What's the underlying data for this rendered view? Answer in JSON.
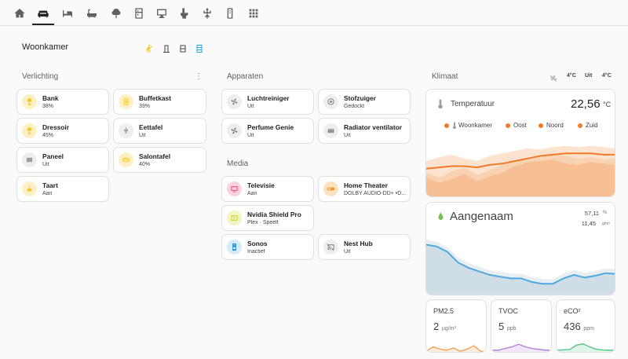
{
  "nav": {
    "tabs": [
      {
        "icon": "home-icon"
      },
      {
        "icon": "sofa-icon",
        "active": true
      },
      {
        "icon": "bed-icon"
      },
      {
        "icon": "bathtub-icon"
      },
      {
        "icon": "tree-icon"
      },
      {
        "icon": "fridge-icon"
      },
      {
        "icon": "desktop-icon"
      },
      {
        "icon": "toilet-icon"
      },
      {
        "icon": "antenna-icon"
      },
      {
        "icon": "remote-icon"
      },
      {
        "icon": "grid-icon"
      }
    ]
  },
  "room": {
    "title": "Woonkamer",
    "header_icons": [
      "motion-icon",
      "door-icon",
      "window-icon",
      "cabinet-icon"
    ]
  },
  "lighting": {
    "title": "Verlichting",
    "menu": "⋮",
    "tiles": [
      {
        "name": "Bank",
        "state": "38%",
        "icon": "lamp-icon",
        "on": true
      },
      {
        "name": "Buffetkast",
        "state": "39%",
        "icon": "lamp-icon",
        "on": true
      },
      {
        "name": "Dressoir",
        "state": "45%",
        "icon": "lamp-icon",
        "on": true
      },
      {
        "name": "Eettafel",
        "state": "Uit",
        "icon": "chandelier-icon",
        "on": false
      },
      {
        "name": "Paneel",
        "state": "Uit",
        "icon": "panel-icon",
        "on": false
      },
      {
        "name": "Salontafel",
        "state": "40%",
        "icon": "ceiling-light-icon",
        "on": true
      },
      {
        "name": "Taart",
        "state": "Aan",
        "icon": "cake-icon",
        "on": true
      }
    ]
  },
  "devices": {
    "title": "Apparaten",
    "tiles": [
      {
        "name": "Luchtreiniger",
        "state": "Uit",
        "icon": "fan-icon"
      },
      {
        "name": "Stofzuiger",
        "state": "Gedockt",
        "icon": "robot-vacuum-icon"
      },
      {
        "name": "Perfume Genie",
        "state": "Uit",
        "icon": "fan-icon"
      },
      {
        "name": "Radiator ventilator",
        "state": "Uit",
        "icon": "radiator-icon"
      }
    ]
  },
  "media": {
    "title": "Media",
    "tiles": [
      {
        "name": "Televisie",
        "state": "Aan",
        "icon": "tv-icon"
      },
      {
        "name": "Home Theater",
        "state": "DOLBY AUDIO-DD+ •D...",
        "icon": "receiver-icon"
      },
      {
        "name": "Nvidia Shield Pro",
        "state": "Plex · Speelt",
        "icon": "play-icon"
      },
      {
        "name": "Sonos",
        "state": "Inactief",
        "icon": "speaker-icon"
      },
      {
        "name": "Nest Hub",
        "state": "Uit",
        "icon": "cast-off-icon"
      }
    ]
  },
  "climate": {
    "title": "Klimaat",
    "top": [
      {
        "icon": "no-wind-icon"
      },
      {
        "label": "4°C"
      },
      {
        "label": "Uit"
      },
      {
        "label": "4°C"
      }
    ],
    "temperature": {
      "label": "Temperatuur",
      "value": "22,56",
      "unit": "°C",
      "legend": [
        "Woonkamer",
        "Oost",
        "Noord",
        "Zuid"
      ],
      "colors": {
        "main": "#f07b26",
        "fill": "#f7c9a3"
      }
    },
    "air": {
      "label": "Aangenaam",
      "humidity": "57,11",
      "humidity_unit": "%",
      "abs": "11,45",
      "abs_unit": "g/m³",
      "colors": {
        "line": "#4fa8e0",
        "fill": "#cfdde6"
      }
    },
    "sensors": [
      {
        "label": "PM2.5",
        "value": "2",
        "unit": "µg/m³",
        "color": "#f39c4c"
      },
      {
        "label": "TVOC",
        "value": "5",
        "unit": "ppb",
        "color": "#b07cd8"
      },
      {
        "label": "eCO²",
        "value": "436",
        "unit": "ppm",
        "color": "#4cc47e"
      }
    ]
  },
  "chart_data": [
    {
      "type": "area",
      "title": "Temperatuur",
      "series": [
        {
          "name": "Woonkamer",
          "values": [
            21.3,
            21.4,
            21.5,
            21.5,
            21.4,
            21.6,
            21.7,
            21.9,
            22.1,
            22.3,
            22.4,
            22.5,
            22.5,
            22.5,
            22.4,
            22.4
          ]
        },
        {
          "name": "Oost",
          "values": [
            21.9,
            22.2,
            22.4,
            22.1,
            21.9,
            22.3,
            22.5,
            22.7,
            22.9,
            22.8,
            23.0,
            23.1,
            23.0,
            23.1,
            23.0,
            22.9
          ]
        },
        {
          "name": "Noord",
          "values": [
            21.0,
            20.6,
            21.1,
            21.4,
            20.8,
            21.2,
            21.6,
            21.9,
            22.0,
            22.2,
            22.4,
            22.3,
            22.1,
            22.2,
            22.0,
            22.1
          ]
        },
        {
          "name": "Zuid",
          "values": [
            20.6,
            20.2,
            20.5,
            20.9,
            20.3,
            20.7,
            21.0,
            21.5,
            21.8,
            21.9,
            22.0,
            21.7,
            21.6,
            21.8,
            21.7,
            21.6
          ]
        }
      ],
      "ylim": [
        19,
        24
      ]
    },
    {
      "type": "line",
      "title": "Aangenaam",
      "series": [
        {
          "values": [
            78,
            76,
            70,
            58,
            52,
            48,
            44,
            42,
            40,
            40,
            36,
            34,
            34,
            40,
            44,
            41,
            43,
            46,
            45
          ]
        }
      ],
      "ylim": [
        20,
        90
      ]
    },
    {
      "type": "line",
      "title": "PM2.5",
      "series": [
        {
          "values": [
            1,
            3,
            2,
            1.5,
            2.5,
            1,
            2,
            3.5,
            1,
            1
          ]
        }
      ],
      "ylim": [
        0,
        6
      ]
    },
    {
      "type": "line",
      "title": "TVOC",
      "series": [
        {
          "values": [
            2,
            2,
            3,
            4,
            5.5,
            4,
            3,
            2.5,
            2,
            2
          ]
        }
      ],
      "ylim": [
        0,
        8
      ]
    },
    {
      "type": "line",
      "title": "eCO²",
      "series": [
        {
          "values": [
            400,
            402,
            404,
            430,
            438,
            420,
            405,
            401,
            400,
            400
          ]
        }
      ],
      "ylim": [
        380,
        460
      ]
    }
  ]
}
